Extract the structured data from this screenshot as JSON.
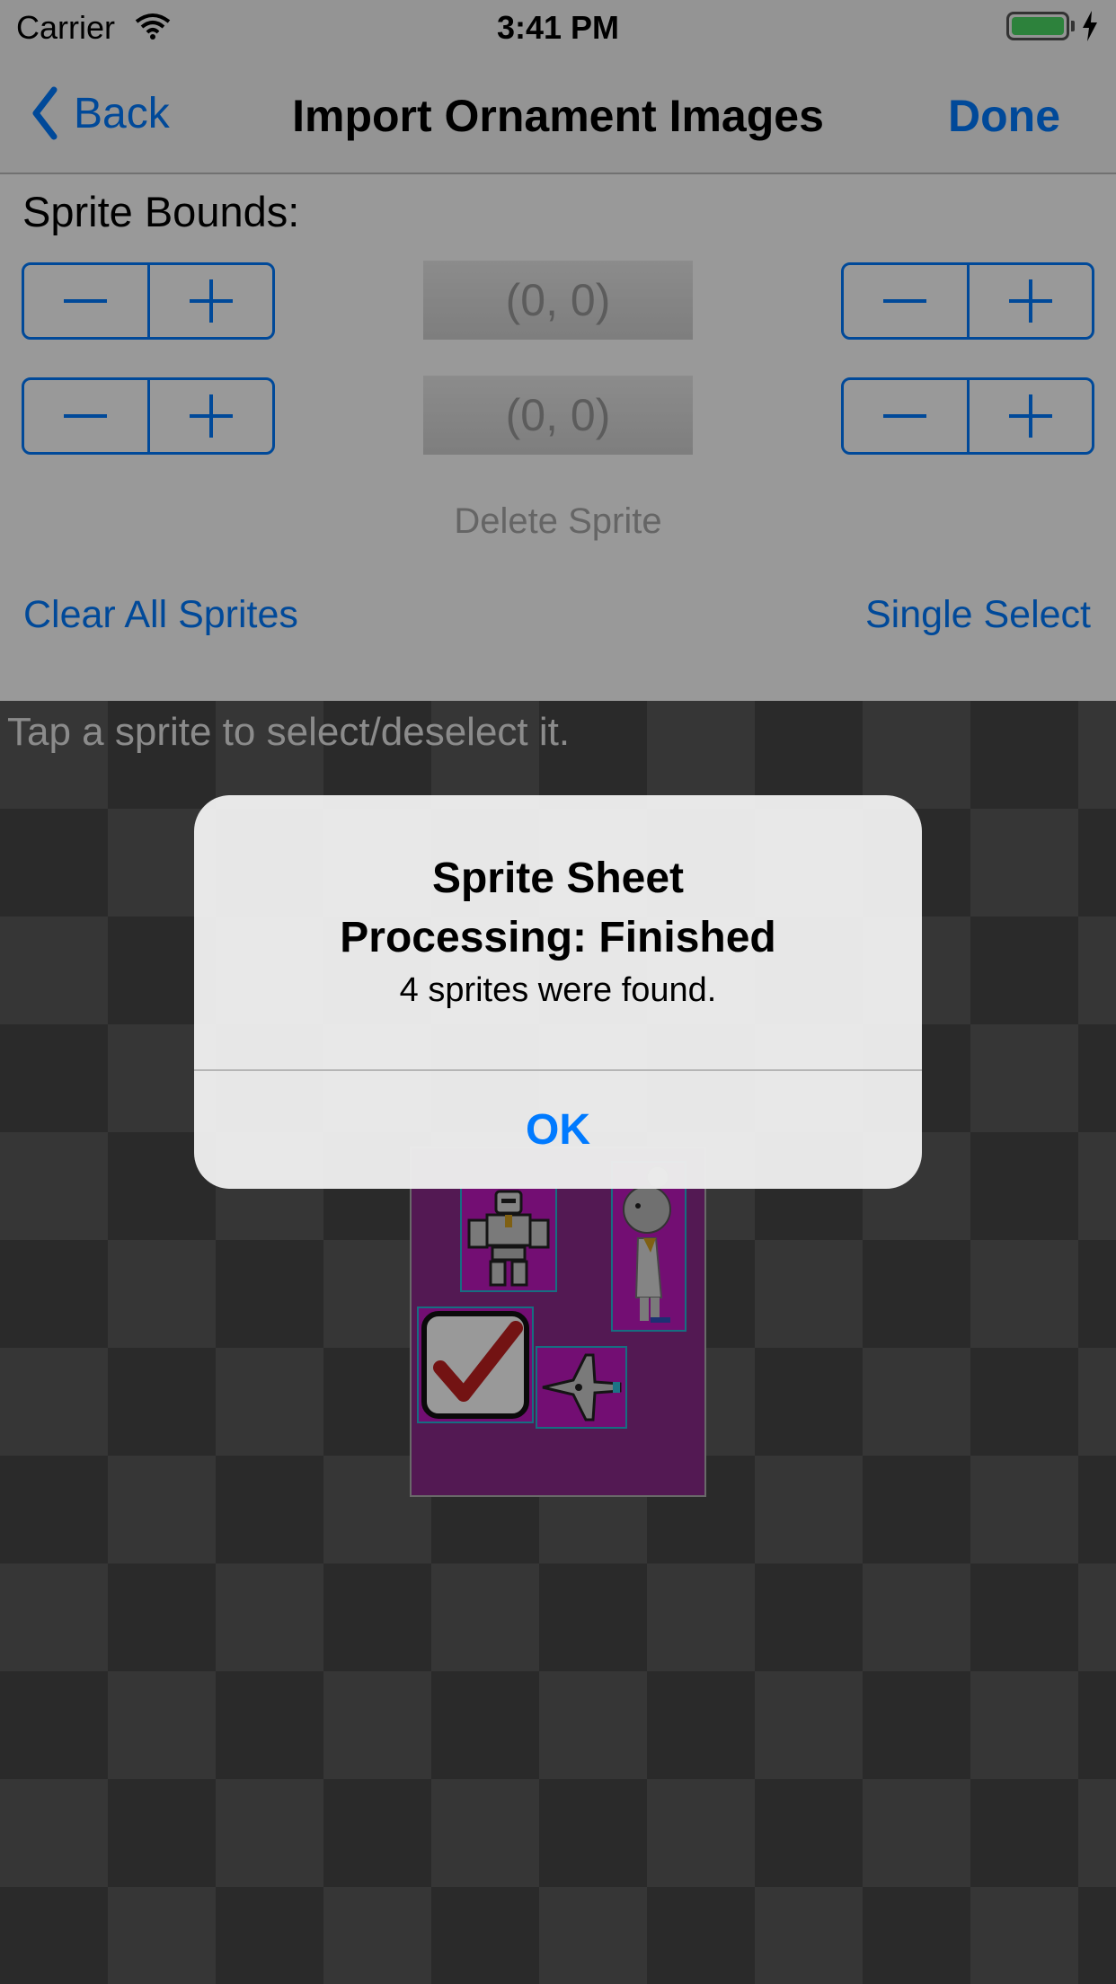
{
  "status_bar": {
    "carrier": "Carrier",
    "time": "3:41 PM"
  },
  "nav": {
    "back_label": "Back",
    "title": "Import Ornament Images",
    "done_label": "Done"
  },
  "controls": {
    "bounds_label": "Sprite Bounds:",
    "row1": {
      "left_minus": "−",
      "left_plus": "+",
      "coord": "(0, 0)",
      "right_minus": "−",
      "right_plus": "+"
    },
    "row2": {
      "left_minus": "−",
      "left_plus": "+",
      "coord": "(0, 0)",
      "right_minus": "−",
      "right_plus": "+"
    },
    "delete_sprite": "Delete Sprite",
    "clear_all": "Clear All Sprites",
    "single_select": "Single Select"
  },
  "canvas": {
    "hint": "Tap a sprite to select/deselect it.",
    "sprites": [
      "robot-sprite",
      "chef-sprite",
      "checkmark-sprite",
      "spaceship-sprite"
    ]
  },
  "alert": {
    "title_line1": "Sprite Sheet",
    "title_line2": "Processing: Finished",
    "message": "4 sprites were found.",
    "ok_label": "OK"
  },
  "colors": {
    "accent": "#007aff",
    "sprite_bg": "#c018c0",
    "sprite_border": "#25b8d8",
    "battery": "#4cd964"
  }
}
